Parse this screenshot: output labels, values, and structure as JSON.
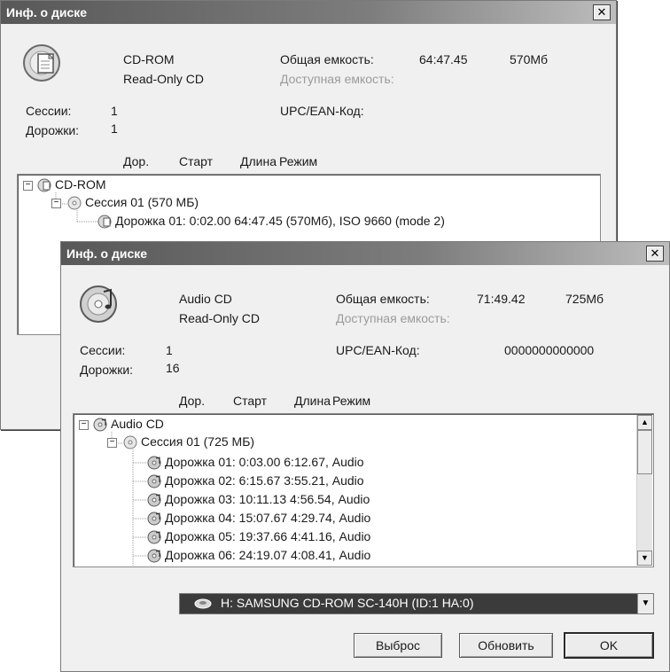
{
  "back_window": {
    "title": "Инф. о диске",
    "close_label": "✕",
    "disc_type": "CD-ROM",
    "disc_media": "Read-Only CD",
    "total_capacity_label": "Общая емкость:",
    "total_capacity_time": "64:47.45",
    "total_capacity_size": "570Мб",
    "available_capacity_label": "Доступная емкость:",
    "sessions_label": "Сессии:",
    "sessions_value": "1",
    "tracks_label": "Дорожки:",
    "tracks_value": "1",
    "upc_label": "UPC/EAN-Код:",
    "columns": [
      "Дор.",
      "Старт",
      "Длина",
      "Режим"
    ],
    "tree": {
      "root": "CD-ROM",
      "session": "Сессия 01 (570 МБ)",
      "tracks": [
        "Дорожка 01: 0:02.00   64:47.45   (570Мб),   ISO 9660 (mode 2)"
      ]
    }
  },
  "front_window": {
    "title": "Инф. о диске",
    "close_label": "✕",
    "disc_type": "Audio CD",
    "disc_media": "Read-Only CD",
    "total_capacity_label": "Общая емкость:",
    "total_capacity_time": "71:49.42",
    "total_capacity_size": "725Мб",
    "available_capacity_label": "Доступная емкость:",
    "sessions_label": "Сессии:",
    "sessions_value": "1",
    "tracks_label": "Дорожки:",
    "tracks_value": "16",
    "upc_label": "UPC/EAN-Код:",
    "upc_value": "0000000000000",
    "columns": [
      "Дор.",
      "Старт",
      "Длина",
      "Режим"
    ],
    "tree": {
      "root": "Audio CD",
      "session": "Сессия 01 (725 МБ)",
      "tracks": [
        "Дорожка 01: 0:03.00   6:12.67,   Audio",
        "Дорожка 02: 6:15.67   3:55.21,   Audio",
        "Дорожка 03: 10:11.13   4:56.54,   Audio",
        "Дорожка 04: 15:07.67   4:29.74,   Audio",
        "Дорожка 05: 19:37.66   4:41.16,   Audio",
        "Дорожка 06: 24:19.07   4:08.41,   Audio"
      ]
    },
    "drive_select": "H: SAMSUNG  CD-ROM SC-140H   (ID:1  HA:0)",
    "buttons": {
      "eject": "Выброс",
      "refresh": "Обновить",
      "ok": "OK"
    },
    "scrollbar": {
      "up": "▲",
      "down": "▼",
      "combo_arrow": "▼"
    }
  }
}
